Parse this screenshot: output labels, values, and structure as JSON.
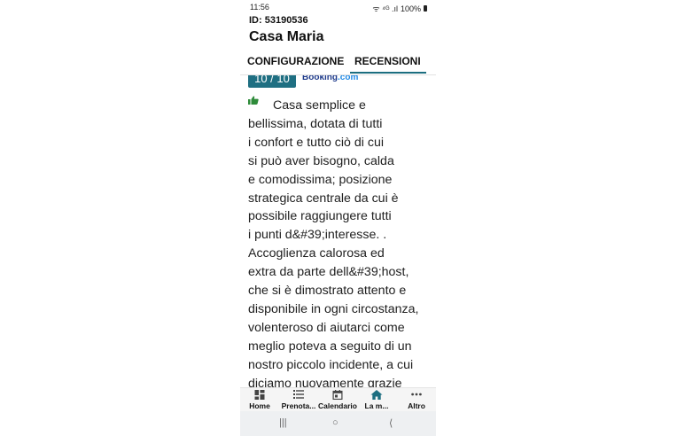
{
  "status_bar": {
    "time": "11:56",
    "signal": "ᯤ ⁴ᴳ .ıl",
    "battery": "100%"
  },
  "header": {
    "id_label": "ID: 53190536",
    "title": "Casa Maria"
  },
  "tabs": [
    {
      "label": "CONFIGURAZIONE",
      "active": false
    },
    {
      "label": "RECENSIONI",
      "active": true
    }
  ],
  "review": {
    "score": "10 / 10",
    "source_prefix": "Booking",
    "source_suffix": ".com",
    "lines": [
      "Casa semplice e",
      "bellissima, dotata di tutti",
      "i confort e tutto ciò di cui",
      "si può aver bisogno, calda",
      "e comodissima; posizione",
      "strategica centrale da cui è",
      "possibile raggiungere tutti",
      "i punti d&#39;interesse. .",
      "Accoglienza calorosa ed",
      "extra da parte dell&#39;host,",
      "che si è dimostrato attento e",
      "disponibile in ogni circostanza,",
      "volenteroso di aiutarci come",
      "meglio poteva a seguito di un",
      "nostro piccolo incidente, a cui",
      "diciamo nuovamente grazie"
    ]
  },
  "bottom_nav": [
    {
      "label": "Home",
      "icon": "dashboard-icon"
    },
    {
      "label": "Prenota...",
      "icon": "list-icon"
    },
    {
      "label": "Calendario",
      "icon": "calendar-icon"
    },
    {
      "label": "La m...",
      "icon": "house-icon"
    },
    {
      "label": "Altro",
      "icon": "more-icon"
    }
  ],
  "colors": {
    "accent": "#1c6e80",
    "score_bg": "#1f6f82",
    "thumb": "#2e8b3a"
  }
}
